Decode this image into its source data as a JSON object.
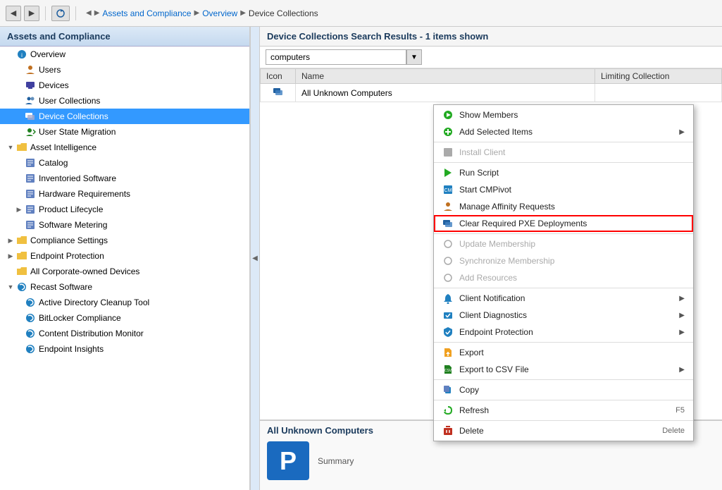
{
  "toolbar": {
    "back_label": "◀",
    "forward_label": "▶",
    "stop_label": "✕",
    "refresh_label": "↺"
  },
  "breadcrumb": {
    "items": [
      {
        "label": "Assets and Compliance",
        "active": false
      },
      {
        "label": "Overview",
        "active": false
      },
      {
        "label": "Device Collections",
        "active": true
      }
    ],
    "separator": "▶"
  },
  "left_panel": {
    "header": "Assets and Compliance",
    "tree": [
      {
        "id": "overview",
        "label": "Overview",
        "level": 0,
        "expand": "",
        "icon": "🔵",
        "selected": false
      },
      {
        "id": "users",
        "label": "Users",
        "level": 1,
        "expand": "",
        "icon": "👤",
        "selected": false
      },
      {
        "id": "devices",
        "label": "Devices",
        "level": 1,
        "expand": "",
        "icon": "💻",
        "selected": false
      },
      {
        "id": "user-collections",
        "label": "User Collections",
        "level": 1,
        "expand": "",
        "icon": "👥",
        "selected": false
      },
      {
        "id": "device-collections",
        "label": "Device Collections",
        "level": 1,
        "expand": "",
        "icon": "🖥",
        "selected": true
      },
      {
        "id": "user-state-migration",
        "label": "User State Migration",
        "level": 1,
        "expand": "",
        "icon": "🔄",
        "selected": false
      },
      {
        "id": "asset-intelligence",
        "label": "Asset Intelligence",
        "level": 0,
        "expand": "▲",
        "icon": "📁",
        "selected": false
      },
      {
        "id": "catalog",
        "label": "Catalog",
        "level": 1,
        "expand": "",
        "icon": "📋",
        "selected": false
      },
      {
        "id": "inventoried-software",
        "label": "Inventoried Software",
        "level": 1,
        "expand": "",
        "icon": "📋",
        "selected": false
      },
      {
        "id": "hardware-requirements",
        "label": "Hardware Requirements",
        "level": 1,
        "expand": "",
        "icon": "📋",
        "selected": false
      },
      {
        "id": "product-lifecycle",
        "label": "Product Lifecycle",
        "level": 1,
        "expand": "▶",
        "icon": "📋",
        "selected": false
      },
      {
        "id": "software-metering",
        "label": "Software Metering",
        "level": 1,
        "expand": "",
        "icon": "📋",
        "selected": false
      },
      {
        "id": "compliance-settings",
        "label": "Compliance Settings",
        "level": 0,
        "expand": "▶",
        "icon": "📁",
        "selected": false
      },
      {
        "id": "endpoint-protection",
        "label": "Endpoint Protection",
        "level": 0,
        "expand": "▶",
        "icon": "📁",
        "selected": false
      },
      {
        "id": "all-corporate-owned",
        "label": "All Corporate-owned Devices",
        "level": 0,
        "expand": "",
        "icon": "📁",
        "selected": false
      },
      {
        "id": "recast-software",
        "label": "Recast Software",
        "level": 0,
        "expand": "▲",
        "icon": "🔵",
        "selected": false
      },
      {
        "id": "ad-cleanup",
        "label": "Active Directory Cleanup Tool",
        "level": 1,
        "expand": "",
        "icon": "🔵",
        "selected": false
      },
      {
        "id": "bitlocker",
        "label": "BitLocker Compliance",
        "level": 1,
        "expand": "",
        "icon": "🔵",
        "selected": false
      },
      {
        "id": "content-dist",
        "label": "Content Distribution Monitor",
        "level": 1,
        "expand": "",
        "icon": "🔵",
        "selected": false
      },
      {
        "id": "endpoint-insights",
        "label": "Endpoint Insights",
        "level": 1,
        "expand": "",
        "icon": "🔵",
        "selected": false
      }
    ]
  },
  "right_panel": {
    "header": "Device Collections Search Results  -  1 items shown",
    "search_value": "computers",
    "table": {
      "columns": [
        "Icon",
        "Name",
        "Limiting Collection"
      ],
      "rows": [
        {
          "icon": "🖥",
          "name": "All Unknown Computers",
          "limiting": ""
        }
      ]
    }
  },
  "context_menu": {
    "items": [
      {
        "id": "show-members",
        "label": "Show Members",
        "icon": "🟢",
        "disabled": false,
        "highlighted": false,
        "has_arrow": false,
        "shortcut": ""
      },
      {
        "id": "add-selected",
        "label": "Add Selected Items",
        "icon": "🟢",
        "disabled": false,
        "highlighted": false,
        "has_arrow": true,
        "shortcut": ""
      },
      {
        "id": "separator1",
        "type": "separator"
      },
      {
        "id": "install-client",
        "label": "Install Client",
        "icon": "📦",
        "disabled": true,
        "highlighted": false,
        "has_arrow": false,
        "shortcut": ""
      },
      {
        "id": "separator2",
        "type": "separator"
      },
      {
        "id": "run-script",
        "label": "Run Script",
        "icon": "▶",
        "disabled": false,
        "highlighted": false,
        "has_arrow": false,
        "shortcut": ""
      },
      {
        "id": "start-cmpivot",
        "label": "Start CMPivot",
        "icon": "📊",
        "disabled": false,
        "highlighted": false,
        "has_arrow": false,
        "shortcut": ""
      },
      {
        "id": "manage-affinity",
        "label": "Manage Affinity Requests",
        "icon": "👤",
        "disabled": false,
        "highlighted": false,
        "has_arrow": false,
        "shortcut": ""
      },
      {
        "id": "clear-pxe",
        "label": "Clear Required PXE Deployments",
        "icon": "🖥",
        "disabled": false,
        "highlighted": true,
        "has_arrow": false,
        "shortcut": ""
      },
      {
        "id": "separator3",
        "type": "separator"
      },
      {
        "id": "update-membership",
        "label": "Update Membership",
        "icon": "🔄",
        "disabled": true,
        "highlighted": false,
        "has_arrow": false,
        "shortcut": ""
      },
      {
        "id": "synchronize",
        "label": "Synchronize Membership",
        "icon": "🔄",
        "disabled": true,
        "highlighted": false,
        "has_arrow": false,
        "shortcut": ""
      },
      {
        "id": "add-resources",
        "label": "Add Resources",
        "icon": "➕",
        "disabled": true,
        "highlighted": false,
        "has_arrow": false,
        "shortcut": ""
      },
      {
        "id": "separator4",
        "type": "separator"
      },
      {
        "id": "client-notification",
        "label": "Client Notification",
        "icon": "🔔",
        "disabled": false,
        "highlighted": false,
        "has_arrow": true,
        "shortcut": ""
      },
      {
        "id": "client-diagnostics",
        "label": "Client Diagnostics",
        "icon": "🔧",
        "disabled": false,
        "highlighted": false,
        "has_arrow": true,
        "shortcut": ""
      },
      {
        "id": "endpoint-protection",
        "label": "Endpoint Protection",
        "icon": "🛡",
        "disabled": false,
        "highlighted": false,
        "has_arrow": true,
        "shortcut": ""
      },
      {
        "id": "separator5",
        "type": "separator"
      },
      {
        "id": "export",
        "label": "Export",
        "icon": "📤",
        "disabled": false,
        "highlighted": false,
        "has_arrow": false,
        "shortcut": ""
      },
      {
        "id": "export-csv",
        "label": "Export to CSV File",
        "icon": "📄",
        "disabled": false,
        "highlighted": false,
        "has_arrow": true,
        "shortcut": ""
      },
      {
        "id": "separator6",
        "type": "separator"
      },
      {
        "id": "copy",
        "label": "Copy",
        "icon": "📋",
        "disabled": false,
        "highlighted": false,
        "has_arrow": false,
        "shortcut": ""
      },
      {
        "id": "separator7",
        "type": "separator"
      },
      {
        "id": "refresh",
        "label": "Refresh",
        "icon": "🔄",
        "disabled": false,
        "highlighted": false,
        "has_arrow": false,
        "shortcut": "F5"
      },
      {
        "id": "separator8",
        "type": "separator"
      },
      {
        "id": "delete",
        "label": "Delete",
        "icon": "🗑",
        "disabled": false,
        "highlighted": false,
        "has_arrow": false,
        "shortcut": "Delete"
      }
    ]
  },
  "bottom_panel": {
    "title": "All Unknown Computers",
    "label": "Summary"
  }
}
